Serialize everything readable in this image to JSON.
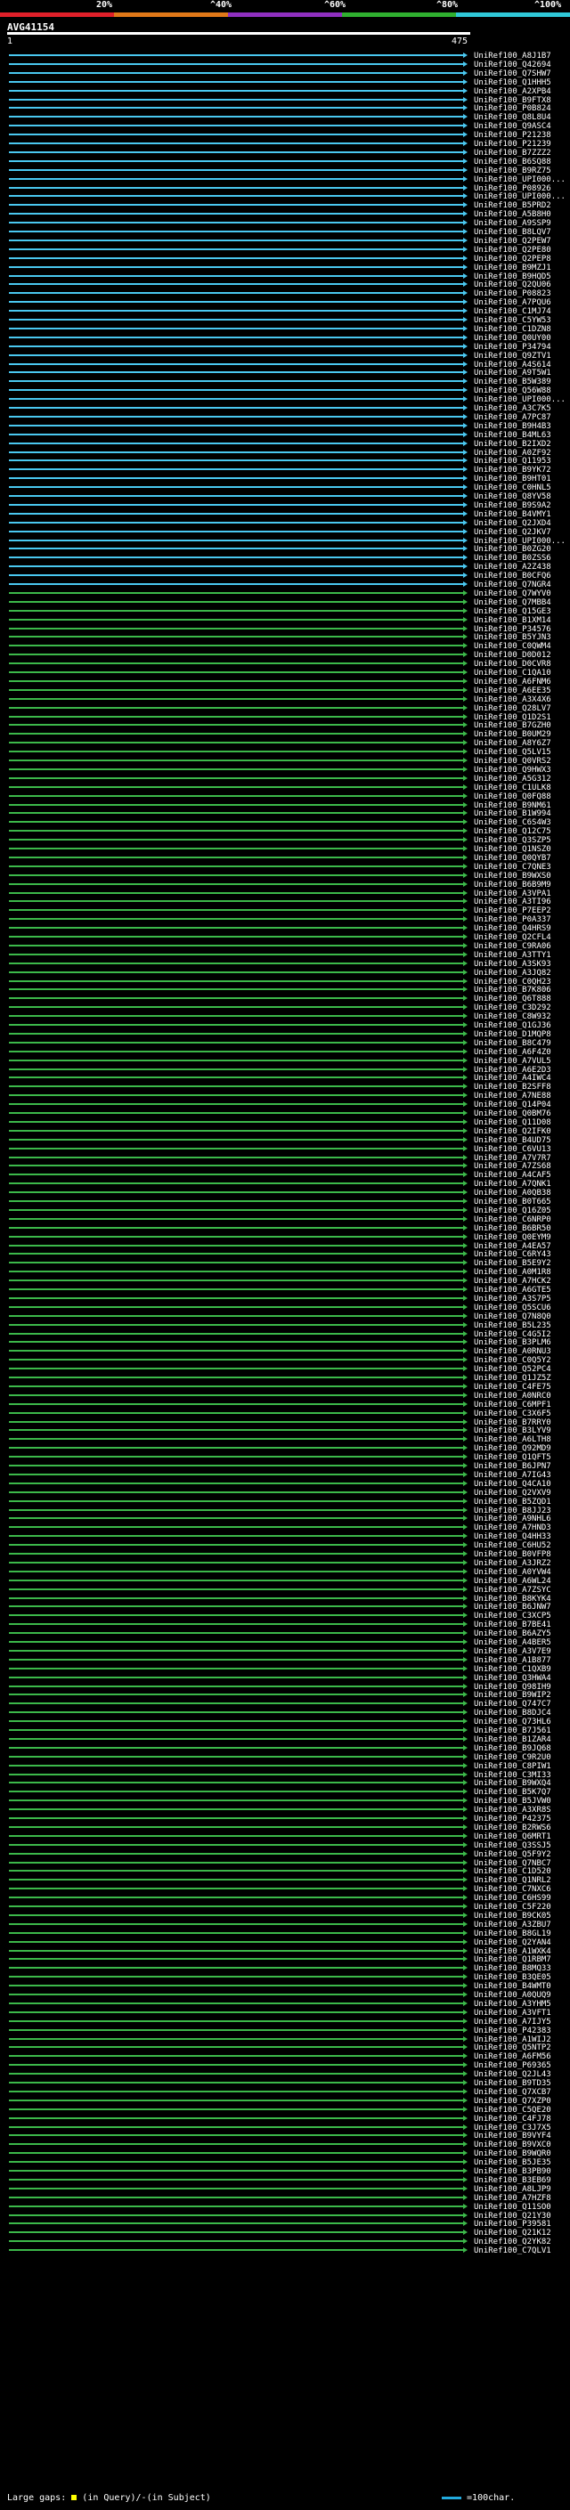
{
  "legend": {
    "labels": [
      "20%",
      "^40%",
      "^60%",
      "^80%",
      "^100%"
    ],
    "colors": [
      "#e0202a",
      "#e07818",
      "#9030c0",
      "#30b030",
      "#30c8d8"
    ]
  },
  "query": {
    "name": "AVG41154",
    "start": "1",
    "end": "475"
  },
  "hits": [
    {
      "id": "UniRef100_A8J1B7",
      "color": "#4ac8f0"
    },
    {
      "id": "UniRef100_Q42694",
      "color": "#4ac8f0"
    },
    {
      "id": "UniRef100_Q7SHW7",
      "color": "#4ac8f0"
    },
    {
      "id": "UniRef100_Q1HHH5",
      "color": "#4ac8f0"
    },
    {
      "id": "UniRef100_A2XPB4",
      "color": "#4ac8f0"
    },
    {
      "id": "UniRef100_B9FTX8",
      "color": "#4ac8f0"
    },
    {
      "id": "UniRef100_P0B824",
      "color": "#4ac8f0"
    },
    {
      "id": "UniRef100_Q8L8U4",
      "color": "#4ac8f0"
    },
    {
      "id": "UniRef100_Q9ASC4",
      "color": "#4ac8f0"
    },
    {
      "id": "UniRef100_P21238",
      "color": "#4ac8f0"
    },
    {
      "id": "UniRef100_P21239",
      "color": "#4ac8f0"
    },
    {
      "id": "UniRef100_B7ZZZ2",
      "color": "#4ac8f0"
    },
    {
      "id": "UniRef100_B6SQ88",
      "color": "#4ac8f0"
    },
    {
      "id": "UniRef100_B9RZ75",
      "color": "#4ac8f0"
    },
    {
      "id": "UniRef100_UPI000...",
      "color": "#4ac8f0"
    },
    {
      "id": "UniRef100_P08926",
      "color": "#4ac8f0"
    },
    {
      "id": "UniRef100_UPI000...",
      "color": "#4ac8f0"
    },
    {
      "id": "UniRef100_B5PRD2",
      "color": "#4ac8f0"
    },
    {
      "id": "UniRef100_A5B8H0",
      "color": "#4ac8f0"
    },
    {
      "id": "UniRef100_A9SSP9",
      "color": "#4ac8f0"
    },
    {
      "id": "UniRef100_B8LQV7",
      "color": "#4ac8f0"
    },
    {
      "id": "UniRef100_Q2PEW7",
      "color": "#4ac8f0"
    },
    {
      "id": "UniRef100_Q2PE80",
      "color": "#4ac8f0"
    },
    {
      "id": "UniRef100_Q2PEP8",
      "color": "#4ac8f0"
    },
    {
      "id": "UniRef100_B9MZJ1",
      "color": "#4ac8f0"
    },
    {
      "id": "UniRef100_B9HQD5",
      "color": "#4ac8f0"
    },
    {
      "id": "UniRef100_Q2QU06",
      "color": "#4ac8f0"
    },
    {
      "id": "UniRef100_P08823",
      "color": "#4ac8f0"
    },
    {
      "id": "UniRef100_A7PQU6",
      "color": "#4ac8f0"
    },
    {
      "id": "UniRef100_C1MJ74",
      "color": "#4ac8f0"
    },
    {
      "id": "UniRef100_C5YW53",
      "color": "#4ac8f0"
    },
    {
      "id": "UniRef100_C1DZN8",
      "color": "#4ac8f0"
    },
    {
      "id": "UniRef100_Q0UY00",
      "color": "#4ac8f0"
    },
    {
      "id": "UniRef100_P34794",
      "color": "#4ac8f0"
    },
    {
      "id": "UniRef100_Q9ZTV1",
      "color": "#4ac8f0"
    },
    {
      "id": "UniRef100_A4S614",
      "color": "#4ac8f0"
    },
    {
      "id": "UniRef100_A9T5W1",
      "color": "#4ac8f0"
    },
    {
      "id": "UniRef100_B5W389",
      "color": "#4ac8f0"
    },
    {
      "id": "UniRef100_Q56W88",
      "color": "#4ac8f0"
    },
    {
      "id": "UniRef100_UPI000...",
      "color": "#4ac8f0"
    },
    {
      "id": "UniRef100_A3C7K5",
      "color": "#4ac8f0"
    },
    {
      "id": "UniRef100_A7PC87",
      "color": "#4ac8f0"
    },
    {
      "id": "UniRef100_B9H4B3",
      "color": "#4ac8f0"
    },
    {
      "id": "UniRef100_B4ML63",
      "color": "#4ac8f0"
    },
    {
      "id": "UniRef100_B2IXD2",
      "color": "#4ac8f0"
    },
    {
      "id": "UniRef100_A0ZF92",
      "color": "#4ac8f0"
    },
    {
      "id": "UniRef100_Q11953",
      "color": "#4ac8f0"
    },
    {
      "id": "UniRef100_B9YK72",
      "color": "#4ac8f0"
    },
    {
      "id": "UniRef100_B9HT01",
      "color": "#4ac8f0"
    },
    {
      "id": "UniRef100_C0HNL5",
      "color": "#4ac8f0"
    },
    {
      "id": "UniRef100_Q8YV58",
      "color": "#4ac8f0"
    },
    {
      "id": "UniRef100_B9S9A2",
      "color": "#4ac8f0"
    },
    {
      "id": "UniRef100_B4VMY1",
      "color": "#4ac8f0"
    },
    {
      "id": "UniRef100_Q2JXD4",
      "color": "#4ac8f0"
    },
    {
      "id": "UniRef100_Q2JKV7",
      "color": "#4ac8f0"
    },
    {
      "id": "UniRef100_UPI000...",
      "color": "#4ac8f0"
    },
    {
      "id": "UniRef100_B0ZG20",
      "color": "#4ac8f0"
    },
    {
      "id": "UniRef100_B0ZSS6",
      "color": "#4ac8f0"
    },
    {
      "id": "UniRef100_A2Z438",
      "color": "#4ac8f0"
    },
    {
      "id": "UniRef100_B0CFQ6",
      "color": "#4ac8f0"
    },
    {
      "id": "UniRef100_Q7NGR4",
      "color": "#4ac8f0"
    },
    {
      "id": "UniRef100_Q7WYV0",
      "color": "#3cb84a"
    },
    {
      "id": "UniRef100_Q7MBB4",
      "color": "#3cb84a"
    },
    {
      "id": "UniRef100_Q15GE3",
      "color": "#3cb84a"
    },
    {
      "id": "UniRef100_B1XM14",
      "color": "#3cb84a"
    },
    {
      "id": "UniRef100_P34576",
      "color": "#3cb84a"
    },
    {
      "id": "UniRef100_B5YJN3",
      "color": "#3cb84a"
    },
    {
      "id": "UniRef100_C0QWM4",
      "color": "#3cb84a"
    },
    {
      "id": "UniRef100_D0D012",
      "color": "#3cb84a"
    },
    {
      "id": "UniRef100_D0CVR8",
      "color": "#3cb84a"
    },
    {
      "id": "UniRef100_C1QA10",
      "color": "#3cb84a"
    },
    {
      "id": "UniRef100_A6FNM6",
      "color": "#3cb84a"
    },
    {
      "id": "UniRef100_A6EE35",
      "color": "#3cb84a"
    },
    {
      "id": "UniRef100_A3X4X6",
      "color": "#3cb84a"
    },
    {
      "id": "UniRef100_Q28LV7",
      "color": "#3cb84a"
    },
    {
      "id": "UniRef100_Q1D2S1",
      "color": "#3cb84a"
    },
    {
      "id": "UniRef100_B7GZH0",
      "color": "#3cb84a"
    },
    {
      "id": "UniRef100_B0UM29",
      "color": "#3cb84a"
    },
    {
      "id": "UniRef100_A8Y6Z7",
      "color": "#3cb84a"
    },
    {
      "id": "UniRef100_Q5LV15",
      "color": "#3cb84a"
    },
    {
      "id": "UniRef100_Q0VRS2",
      "color": "#3cb84a"
    },
    {
      "id": "UniRef100_Q9HWX3",
      "color": "#3cb84a"
    },
    {
      "id": "UniRef100_A5G312",
      "color": "#3cb84a"
    },
    {
      "id": "UniRef100_C1ULK8",
      "color": "#3cb84a"
    },
    {
      "id": "UniRef100_Q0FQ88",
      "color": "#3cb84a"
    },
    {
      "id": "UniRef100_B9NM61",
      "color": "#3cb84a"
    },
    {
      "id": "UniRef100_B1W994",
      "color": "#3cb84a"
    },
    {
      "id": "UniRef100_C6S4W3",
      "color": "#3cb84a"
    },
    {
      "id": "UniRef100_Q12C75",
      "color": "#3cb84a"
    },
    {
      "id": "UniRef100_Q3SZP5",
      "color": "#3cb84a"
    },
    {
      "id": "UniRef100_Q1NSZ0",
      "color": "#3cb84a"
    },
    {
      "id": "UniRef100_Q0QYB7",
      "color": "#3cb84a"
    },
    {
      "id": "UniRef100_C7QNE3",
      "color": "#3cb84a"
    },
    {
      "id": "UniRef100_B9WXS0",
      "color": "#3cb84a"
    },
    {
      "id": "UniRef100_B6B9M9",
      "color": "#3cb84a"
    },
    {
      "id": "UniRef100_A3VPA1",
      "color": "#3cb84a"
    },
    {
      "id": "UniRef100_A3TI96",
      "color": "#3cb84a"
    },
    {
      "id": "UniRef100_P7EEP2",
      "color": "#3cb84a"
    },
    {
      "id": "UniRef100_P0A337",
      "color": "#3cb84a"
    },
    {
      "id": "UniRef100_Q4HRS9",
      "color": "#3cb84a"
    },
    {
      "id": "UniRef100_Q2CFL4",
      "color": "#3cb84a"
    },
    {
      "id": "UniRef100_C9RA06",
      "color": "#3cb84a"
    },
    {
      "id": "UniRef100_A3TTY1",
      "color": "#3cb84a"
    },
    {
      "id": "UniRef100_A3SK93",
      "color": "#3cb84a"
    },
    {
      "id": "UniRef100_A3JQ82",
      "color": "#3cb84a"
    },
    {
      "id": "UniRef100_C0QH23",
      "color": "#3cb84a"
    },
    {
      "id": "UniRef100_B7K806",
      "color": "#3cb84a"
    },
    {
      "id": "UniRef100_Q6T888",
      "color": "#3cb84a"
    },
    {
      "id": "UniRef100_C3D292",
      "color": "#3cb84a"
    },
    {
      "id": "UniRef100_C8W932",
      "color": "#3cb84a"
    },
    {
      "id": "UniRef100_Q1GJ36",
      "color": "#3cb84a"
    },
    {
      "id": "UniRef100_D1MQP8",
      "color": "#3cb84a"
    },
    {
      "id": "UniRef100_B8C479",
      "color": "#3cb84a"
    },
    {
      "id": "UniRef100_A6F4Z0",
      "color": "#3cb84a"
    },
    {
      "id": "UniRef100_A7VUL5",
      "color": "#3cb84a"
    },
    {
      "id": "UniRef100_A6E2D3",
      "color": "#3cb84a"
    },
    {
      "id": "UniRef100_A4IWC4",
      "color": "#3cb84a"
    },
    {
      "id": "UniRef100_B2SFF8",
      "color": "#3cb84a"
    },
    {
      "id": "UniRef100_A7NE88",
      "color": "#3cb84a"
    },
    {
      "id": "UniRef100_Q14P04",
      "color": "#3cb84a"
    },
    {
      "id": "UniRef100_Q0BM76",
      "color": "#3cb84a"
    },
    {
      "id": "UniRef100_Q11D08",
      "color": "#3cb84a"
    },
    {
      "id": "UniRef100_Q2IFK0",
      "color": "#3cb84a"
    },
    {
      "id": "UniRef100_B4UD75",
      "color": "#3cb84a"
    },
    {
      "id": "UniRef100_C6VU13",
      "color": "#3cb84a"
    },
    {
      "id": "UniRef100_A7V7R7",
      "color": "#3cb84a"
    },
    {
      "id": "UniRef100_A7ZS68",
      "color": "#3cb84a"
    },
    {
      "id": "UniRef100_A4CAF5",
      "color": "#3cb84a"
    },
    {
      "id": "UniRef100_A7QNK1",
      "color": "#3cb84a"
    },
    {
      "id": "UniRef100_A0QB38",
      "color": "#3cb84a"
    },
    {
      "id": "UniRef100_B0T665",
      "color": "#3cb84a"
    },
    {
      "id": "UniRef100_Q16Z05",
      "color": "#3cb84a"
    },
    {
      "id": "UniRef100_C6NRP0",
      "color": "#3cb84a"
    },
    {
      "id": "UniRef100_B6BR50",
      "color": "#3cb84a"
    },
    {
      "id": "UniRef100_Q0EYM9",
      "color": "#3cb84a"
    },
    {
      "id": "UniRef100_A4EA57",
      "color": "#3cb84a"
    },
    {
      "id": "UniRef100_C6RY43",
      "color": "#3cb84a"
    },
    {
      "id": "UniRef100_B5E9Y2",
      "color": "#3cb84a"
    },
    {
      "id": "UniRef100_A0M1R8",
      "color": "#3cb84a"
    },
    {
      "id": "UniRef100_A7HCK2",
      "color": "#3cb84a"
    },
    {
      "id": "UniRef100_A6GTE5",
      "color": "#3cb84a"
    },
    {
      "id": "UniRef100_A3S7P5",
      "color": "#3cb84a"
    },
    {
      "id": "UniRef100_Q5SCU6",
      "color": "#3cb84a"
    },
    {
      "id": "UniRef100_Q7N8Q0",
      "color": "#3cb84a"
    },
    {
      "id": "UniRef100_B5L235",
      "color": "#3cb84a"
    },
    {
      "id": "UniRef100_C4G5I2",
      "color": "#3cb84a"
    },
    {
      "id": "UniRef100_B3PLM6",
      "color": "#3cb84a"
    },
    {
      "id": "UniRef100_A0RNU3",
      "color": "#3cb84a"
    },
    {
      "id": "UniRef100_C0Q5Y2",
      "color": "#3cb84a"
    },
    {
      "id": "UniRef100_Q52PC4",
      "color": "#3cb84a"
    },
    {
      "id": "UniRef100_Q1JZ5Z",
      "color": "#3cb84a"
    },
    {
      "id": "UniRef100_C4FE75",
      "color": "#3cb84a"
    },
    {
      "id": "UniRef100_A0NRC0",
      "color": "#3cb84a"
    },
    {
      "id": "UniRef100_C6MPF1",
      "color": "#3cb84a"
    },
    {
      "id": "UniRef100_C3X6F5",
      "color": "#3cb84a"
    },
    {
      "id": "UniRef100_B7RRY0",
      "color": "#3cb84a"
    },
    {
      "id": "UniRef100_B3LYV9",
      "color": "#3cb84a"
    },
    {
      "id": "UniRef100_A6LTH8",
      "color": "#3cb84a"
    },
    {
      "id": "UniRef100_Q92MD9",
      "color": "#3cb84a"
    },
    {
      "id": "UniRef100_Q1QFT5",
      "color": "#3cb84a"
    },
    {
      "id": "UniRef100_B6JPN7",
      "color": "#3cb84a"
    },
    {
      "id": "UniRef100_A7IG43",
      "color": "#3cb84a"
    },
    {
      "id": "UniRef100_Q4CA10",
      "color": "#3cb84a"
    },
    {
      "id": "UniRef100_Q2VXV9",
      "color": "#3cb84a"
    },
    {
      "id": "UniRef100_B5ZQD1",
      "color": "#3cb84a"
    },
    {
      "id": "UniRef100_B8JJ23",
      "color": "#3cb84a"
    },
    {
      "id": "UniRef100_A9NHL6",
      "color": "#3cb84a"
    },
    {
      "id": "UniRef100_A7HND3",
      "color": "#3cb84a"
    },
    {
      "id": "UniRef100_Q4HH33",
      "color": "#3cb84a"
    },
    {
      "id": "UniRef100_C6HU52",
      "color": "#3cb84a"
    },
    {
      "id": "UniRef100_B0VFP8",
      "color": "#3cb84a"
    },
    {
      "id": "UniRef100_A3JRZ2",
      "color": "#3cb84a"
    },
    {
      "id": "UniRef100_A0YVW4",
      "color": "#3cb84a"
    },
    {
      "id": "UniRef100_A6WL24",
      "color": "#3cb84a"
    },
    {
      "id": "UniRef100_A7ZSYC",
      "color": "#3cb84a"
    },
    {
      "id": "UniRef100_B8KYK4",
      "color": "#3cb84a"
    },
    {
      "id": "UniRef100_B6JNW7",
      "color": "#3cb84a"
    },
    {
      "id": "UniRef100_C3XCP5",
      "color": "#3cb84a"
    },
    {
      "id": "UniRef100_B7BE41",
      "color": "#3cb84a"
    },
    {
      "id": "UniRef100_B6AZY5",
      "color": "#3cb84a"
    },
    {
      "id": "UniRef100_A4BER5",
      "color": "#3cb84a"
    },
    {
      "id": "UniRef100_A3V7E9",
      "color": "#3cb84a"
    },
    {
      "id": "UniRef100_A1B877",
      "color": "#3cb84a"
    },
    {
      "id": "UniRef100_C1QXB9",
      "color": "#3cb84a"
    },
    {
      "id": "UniRef100_Q3HWA4",
      "color": "#3cb84a"
    },
    {
      "id": "UniRef100_Q98IH9",
      "color": "#3cb84a"
    },
    {
      "id": "UniRef100_B9WIP2",
      "color": "#3cb84a"
    },
    {
      "id": "UniRef100_Q747C7",
      "color": "#3cb84a"
    },
    {
      "id": "UniRef100_B8DJC4",
      "color": "#3cb84a"
    },
    {
      "id": "UniRef100_Q73HL6",
      "color": "#3cb84a"
    },
    {
      "id": "UniRef100_B7J561",
      "color": "#3cb84a"
    },
    {
      "id": "UniRef100_B1ZAR4",
      "color": "#3cb84a"
    },
    {
      "id": "UniRef100_B9JQ68",
      "color": "#3cb84a"
    },
    {
      "id": "UniRef100_C9R2U0",
      "color": "#3cb84a"
    },
    {
      "id": "UniRef100_C8PIW1",
      "color": "#3cb84a"
    },
    {
      "id": "UniRef100_C3MI33",
      "color": "#3cb84a"
    },
    {
      "id": "UniRef100_B9WXQ4",
      "color": "#3cb84a"
    },
    {
      "id": "UniRef100_B5K7Q7",
      "color": "#3cb84a"
    },
    {
      "id": "UniRef100_B5JVW0",
      "color": "#3cb84a"
    },
    {
      "id": "UniRef100_A3XR8S",
      "color": "#3cb84a"
    },
    {
      "id": "UniRef100_P42375",
      "color": "#3cb84a"
    },
    {
      "id": "UniRef100_B2RWS6",
      "color": "#3cb84a"
    },
    {
      "id": "UniRef100_Q6MRT1",
      "color": "#3cb84a"
    },
    {
      "id": "UniRef100_Q3SSJ5",
      "color": "#3cb84a"
    },
    {
      "id": "UniRef100_Q5F9Y2",
      "color": "#3cb84a"
    },
    {
      "id": "UniRef100_Q7NBC7",
      "color": "#3cb84a"
    },
    {
      "id": "UniRef100_C1D520",
      "color": "#3cb84a"
    },
    {
      "id": "UniRef100_Q1NRL2",
      "color": "#3cb84a"
    },
    {
      "id": "UniRef100_C7NXC6",
      "color": "#3cb84a"
    },
    {
      "id": "UniRef100_C6HS99",
      "color": "#3cb84a"
    },
    {
      "id": "UniRef100_C5F220",
      "color": "#3cb84a"
    },
    {
      "id": "UniRef100_B9CK05",
      "color": "#3cb84a"
    },
    {
      "id": "UniRef100_A3ZBU7",
      "color": "#3cb84a"
    },
    {
      "id": "UniRef100_B8GL19",
      "color": "#3cb84a"
    },
    {
      "id": "UniRef100_Q2YAN4",
      "color": "#3cb84a"
    },
    {
      "id": "UniRef100_A1WXK4",
      "color": "#3cb84a"
    },
    {
      "id": "UniRef100_Q1RBM7",
      "color": "#3cb84a"
    },
    {
      "id": "UniRef100_B8MQ33",
      "color": "#3cb84a"
    },
    {
      "id": "UniRef100_B3QE05",
      "color": "#3cb84a"
    },
    {
      "id": "UniRef100_B4WMT0",
      "color": "#3cb84a"
    },
    {
      "id": "UniRef100_A0QUQ9",
      "color": "#3cb84a"
    },
    {
      "id": "UniRef100_A3YHM5",
      "color": "#3cb84a"
    },
    {
      "id": "UniRef100_A3VFT1",
      "color": "#3cb84a"
    },
    {
      "id": "UniRef100_A7IJY5",
      "color": "#3cb84a"
    },
    {
      "id": "UniRef100_P42383",
      "color": "#3cb84a"
    },
    {
      "id": "UniRef100_A1WIJ2",
      "color": "#3cb84a"
    },
    {
      "id": "UniRef100_Q5NTP2",
      "color": "#3cb84a"
    },
    {
      "id": "UniRef100_A6FM56",
      "color": "#3cb84a"
    },
    {
      "id": "UniRef100_P69365",
      "color": "#3cb84a"
    },
    {
      "id": "UniRef100_Q2JL43",
      "color": "#3cb84a"
    },
    {
      "id": "UniRef100_B9TD35",
      "color": "#3cb84a"
    },
    {
      "id": "UniRef100_Q7XCB7",
      "color": "#3cb84a"
    },
    {
      "id": "UniRef100_Q7XZP0",
      "color": "#3cb84a"
    },
    {
      "id": "UniRef100_C5QE20",
      "color": "#3cb84a"
    },
    {
      "id": "UniRef100_C4FJ78",
      "color": "#3cb84a"
    },
    {
      "id": "UniRef100_C3J7X5",
      "color": "#3cb84a"
    },
    {
      "id": "UniRef100_B9VYF4",
      "color": "#3cb84a"
    },
    {
      "id": "UniRef100_B9VXC0",
      "color": "#3cb84a"
    },
    {
      "id": "UniRef100_B9WQR0",
      "color": "#3cb84a"
    },
    {
      "id": "UniRef100_B5JE35",
      "color": "#3cb84a"
    },
    {
      "id": "UniRef100_B3PB90",
      "color": "#3cb84a"
    },
    {
      "id": "UniRef100_B3EB69",
      "color": "#3cb84a"
    },
    {
      "id": "UniRef100_A8LJP9",
      "color": "#3cb84a"
    },
    {
      "id": "UniRef100_A7HZF8",
      "color": "#3cb84a"
    },
    {
      "id": "UniRef100_Q11SO0",
      "color": "#3cb84a"
    },
    {
      "id": "UniRef100_Q21Y30",
      "color": "#3cb84a"
    },
    {
      "id": "UniRef100_P39581",
      "color": "#3cb84a"
    },
    {
      "id": "UniRef100_Q21K12",
      "color": "#3cb84a"
    },
    {
      "id": "UniRef100_Q2YK82",
      "color": "#3cb84a"
    },
    {
      "id": "UniRef100_C7QLV1",
      "color": "#3cb84a"
    }
  ],
  "footer": {
    "large_gaps": "Large gaps:",
    "in_query": "(in Query)",
    "slash": "/",
    "in_subject": "-(in Subject)",
    "scale_label": "=100char."
  }
}
